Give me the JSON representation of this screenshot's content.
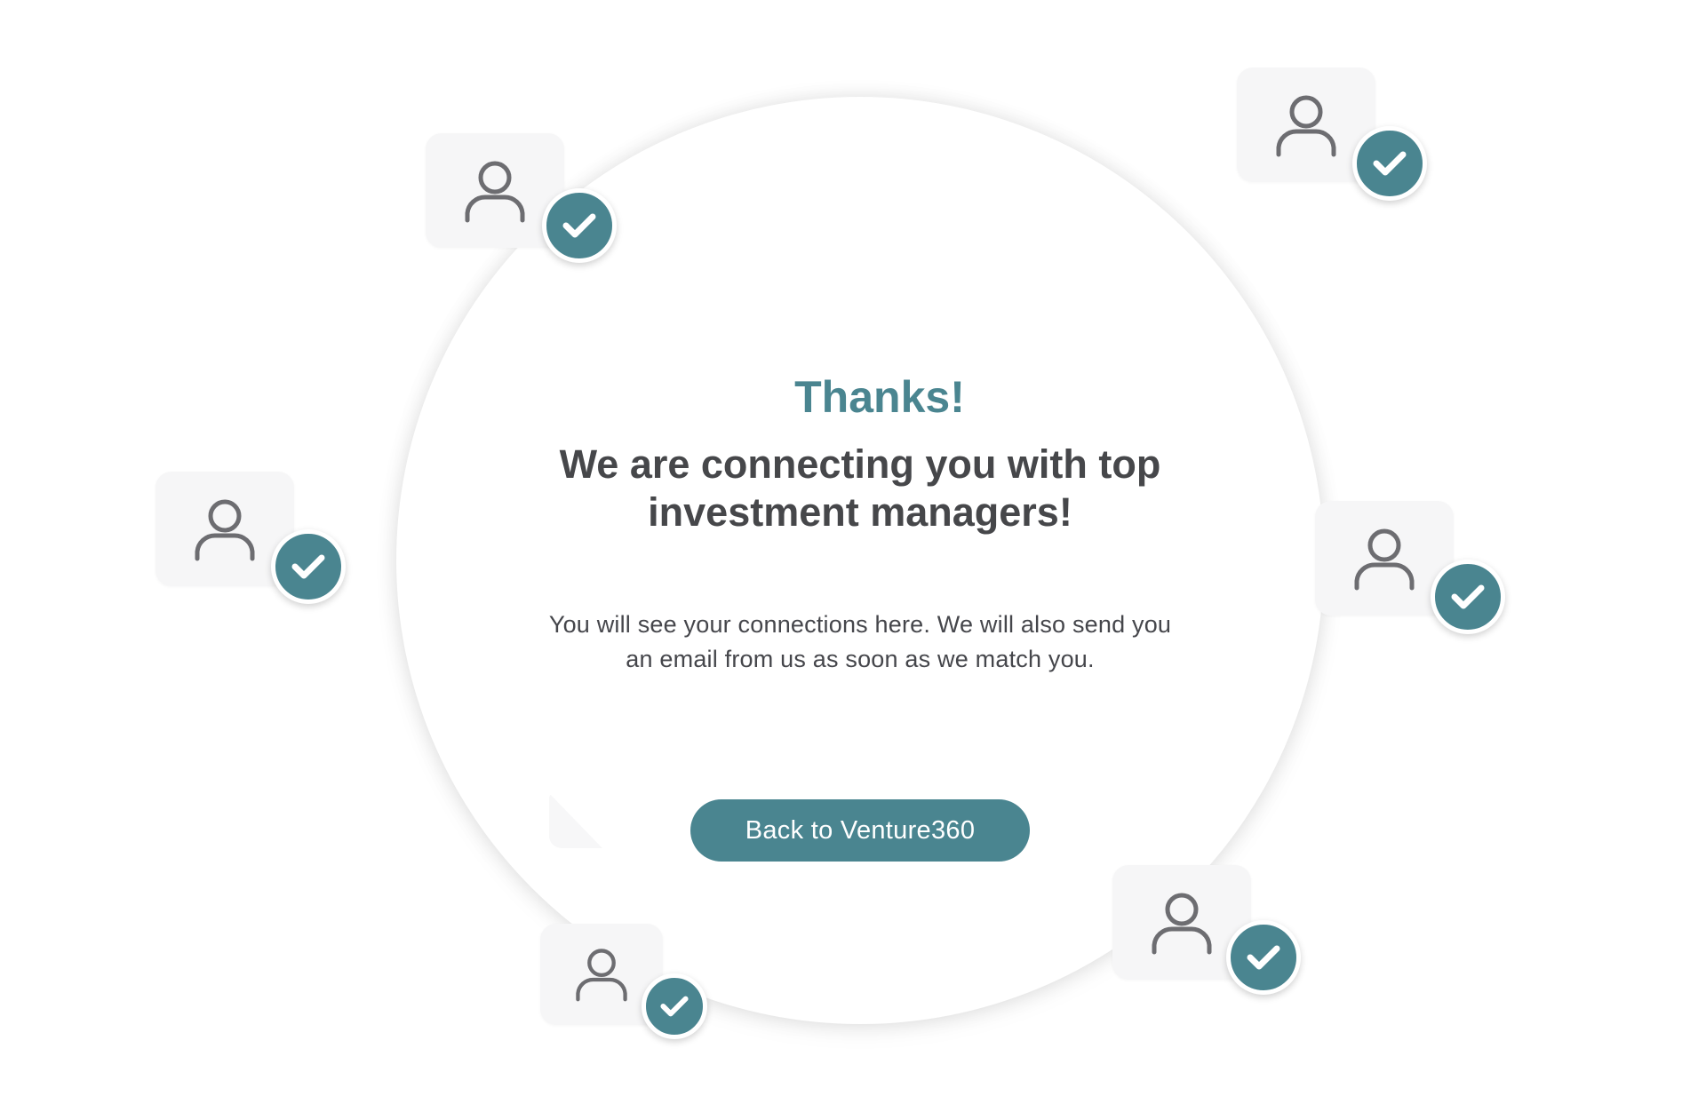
{
  "main": {
    "thanks_title": "Thanks!",
    "headline": "We are connecting you with top investment managers!",
    "message": "You will see your connections here. We will also send you an email from us as soon as we match you.",
    "back_button_label": "Back to Venture360"
  },
  "user_cards": [
    {
      "icon": "user-icon",
      "badge_icon": "check-icon"
    },
    {
      "icon": "user-icon",
      "badge_icon": "check-icon"
    },
    {
      "icon": "user-icon",
      "badge_icon": "check-icon"
    },
    {
      "icon": "user-icon",
      "badge_icon": "check-icon"
    },
    {
      "icon": "user-icon",
      "badge_icon": "check-icon"
    },
    {
      "icon": "user-icon",
      "badge_icon": "check-icon"
    }
  ],
  "colors": {
    "accent": "#4a8590",
    "headline_text": "#46474a",
    "body_text": "#45464b",
    "card_background": "#f6f6f7",
    "page_background": "#ffffff"
  }
}
